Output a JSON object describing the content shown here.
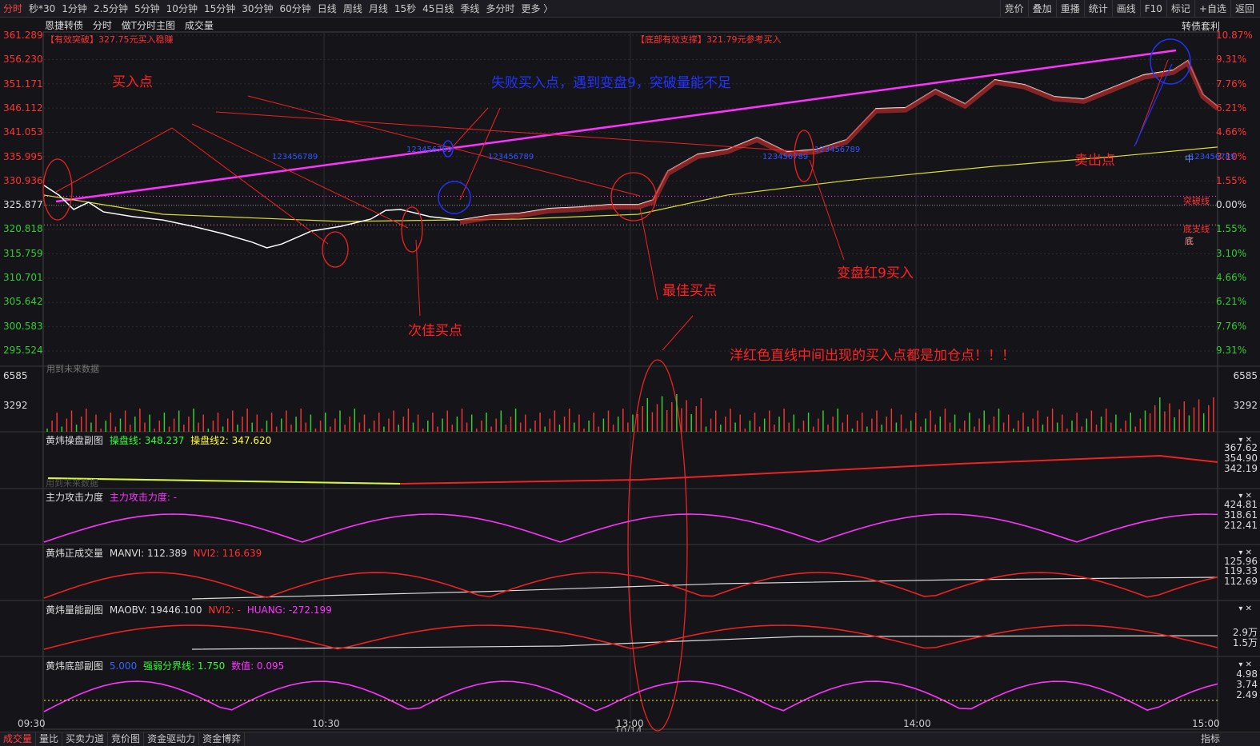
{
  "topbar": {
    "tabs": [
      "分时",
      "秒*30",
      "1分钟",
      "2.5分钟",
      "5分钟",
      "10分钟",
      "15分钟",
      "30分钟",
      "60分钟",
      "日线",
      "周线",
      "月线",
      "15秒",
      "45日线",
      "季线",
      "多分时",
      "更多 〉"
    ],
    "active_index": 0,
    "right_buttons": [
      "竞价",
      "叠加",
      "重播",
      "统计",
      "画线",
      "F10",
      "标记",
      "+自选",
      "返回"
    ]
  },
  "info": {
    "name": "恩捷转债",
    "mode": "分时",
    "main_chart": "做T分时主图",
    "volume": "成交量",
    "arbitrage": "转债套利",
    "effective_break": "【有效突破】327.75元买入稳赚",
    "bottom_support": "【底部有效支撑】321.79元参考买入",
    "future_data": "用到未来数据"
  },
  "price_axis": {
    "left": [
      "361.289",
      "356.230",
      "351.171",
      "346.112",
      "341.053",
      "335.995",
      "330.936",
      "325.877",
      "320.818",
      "315.759",
      "310.701",
      "305.642",
      "300.583",
      "295.524"
    ],
    "right": [
      "10.87%",
      "9.31%",
      "7.76%",
      "6.21%",
      "4.66%",
      "3.10%",
      "1.55%",
      "0.00%",
      "1.55%",
      "3.10%",
      "4.66%",
      "6.21%",
      "7.76%",
      "9.31%"
    ],
    "colors": {
      "up": "#ff3333",
      "down": "#33cc33",
      "flat": "#dddddd"
    }
  },
  "volume_axis": {
    "left": [
      "6585",
      "3292"
    ],
    "right": [
      "6585",
      "3292"
    ]
  },
  "chart_labels": {
    "breakout_line": "突破线",
    "support_line": "底支线",
    "bottom": "底",
    "mid": "中",
    "seq_1": "123456789",
    "seq_2": "123456789",
    "seq_3": "123456789",
    "seq_4": "123456789",
    "seq_5": "123456789",
    "seq_6": "123456789",
    "seq_7": "123456789"
  },
  "annotations": {
    "buy_point": "买入点",
    "failed_buy": "失败买入点，遇到变盘9，突破量能不足",
    "second_best": "次佳买点",
    "best": "最佳买点",
    "change9": "变盘红9买入",
    "sell_point": "卖出点",
    "add_position": "洋红色直线中间出现的买入点都是加仓点！！！"
  },
  "panels": {
    "p1": {
      "title": "黄炜操盘副图",
      "l1": "操盘线: 348.237",
      "l2": "操盘线2: 347.620",
      "vals": [
        "367.62",
        "354.90",
        "342.19"
      ],
      "future": "用到未来数据"
    },
    "p2": {
      "title": "主力攻击力度",
      "l1": "主力攻击力度: -",
      "vals": [
        "424.81",
        "318.61",
        "212.41"
      ]
    },
    "p3": {
      "title": "黄炜正成交量",
      "l1": "MANVI: 112.389",
      "l2": "NVI2: 116.639",
      "vals": [
        "125.96",
        "119.33",
        "112.69"
      ]
    },
    "p4": {
      "title": "黄炜量能副图",
      "l1": "MAOBV: 19446.100",
      "l2": "NVI2: -",
      "l3": "HUANG: -272.199",
      "vals": [
        "2.9万",
        "1.5万"
      ]
    },
    "p5": {
      "title": "黄炜底部副图",
      "l1": "5.000",
      "l2": "强弱分界线: 1.750",
      "l3": "数值: 0.095",
      "vals": [
        "4.98",
        "3.74",
        "2.49"
      ]
    }
  },
  "time_axis": {
    "labels": [
      "09:30",
      "10:30",
      "13:00",
      "14:00",
      "15:00"
    ],
    "date": "10/14"
  },
  "bottombar": {
    "tabs": [
      "成交量",
      "量比",
      "买卖力道",
      "竞价图",
      "资金驱动力",
      "资金博弈"
    ],
    "active_index": 0,
    "right": "指标"
  },
  "chart_data": {
    "type": "line",
    "title": "恩捷转债",
    "y_range": [
      295.524,
      361.289
    ],
    "prev_close": 325.877,
    "price_approx": [
      [
        0,
        330.0
      ],
      [
        5,
        328.0
      ],
      [
        10,
        325.0
      ],
      [
        15,
        326.5
      ],
      [
        20,
        324.5
      ],
      [
        30,
        323.5
      ],
      [
        40,
        322.8
      ],
      [
        50,
        321.5
      ],
      [
        60,
        320.0
      ],
      [
        70,
        318.2
      ],
      [
        75,
        317.0
      ],
      [
        80,
        317.8
      ],
      [
        90,
        320.5
      ],
      [
        100,
        321.5
      ],
      [
        110,
        323.0
      ],
      [
        115,
        324.8
      ],
      [
        120,
        325.0
      ],
      [
        130,
        323.5
      ],
      [
        140,
        322.8
      ],
      [
        150,
        323.8
      ],
      [
        160,
        324.2
      ],
      [
        170,
        325.2
      ],
      [
        180,
        325.5
      ],
      [
        190,
        326.0
      ],
      [
        200,
        326.0
      ],
      [
        205,
        327.0
      ],
      [
        210,
        333.0
      ],
      [
        220,
        336.5
      ],
      [
        230,
        337.5
      ],
      [
        240,
        340.0
      ],
      [
        250,
        337.0
      ],
      [
        260,
        337.5
      ],
      [
        270,
        339.5
      ],
      [
        280,
        346.0
      ],
      [
        290,
        346.2
      ],
      [
        300,
        350.0
      ],
      [
        310,
        347.0
      ],
      [
        320,
        352.0
      ],
      [
        330,
        351.0
      ],
      [
        340,
        348.5
      ],
      [
        350,
        348.0
      ],
      [
        360,
        350.5
      ],
      [
        370,
        353.0
      ],
      [
        380,
        354.0
      ],
      [
        385,
        356.0
      ],
      [
        390,
        349.0
      ],
      [
        395,
        346.5
      ]
    ],
    "breakout_line": 327.75,
    "support_line": 321.79
  }
}
